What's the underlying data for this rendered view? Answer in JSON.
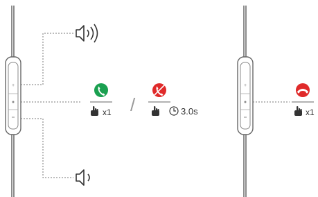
{
  "colors": {
    "answer": "#1aa050",
    "reject": "#e02a2a",
    "hangup": "#e02a2a",
    "line": "#777777",
    "hand": "#333333"
  },
  "actions": {
    "answer": {
      "icon": "phone-answer-icon",
      "gesture": "hand-press-icon",
      "count": "x1"
    },
    "separator": "/",
    "reject": {
      "icon": "phone-reject-icon",
      "gesture": "hand-press-icon",
      "timer_icon": "clock-icon",
      "duration": "3.0s"
    },
    "hangup": {
      "icon": "phone-hangup-icon",
      "gesture": "hand-press-icon",
      "count": "x1"
    }
  },
  "volume": {
    "up_icon": "volume-up-icon",
    "down_icon": "volume-down-icon"
  }
}
